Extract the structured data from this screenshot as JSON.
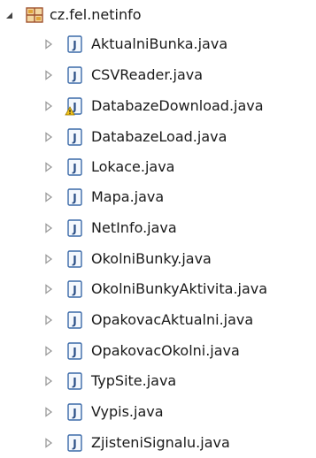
{
  "tree": {
    "package": {
      "label": "cz.fel.netinfo",
      "expanded": true,
      "icon": "package-icon"
    },
    "files": [
      {
        "label": "AktualniBunka.java",
        "icon": "java-file-icon",
        "warning": false
      },
      {
        "label": "CSVReader.java",
        "icon": "java-file-icon",
        "warning": false
      },
      {
        "label": "DatabazeDownload.java",
        "icon": "java-file-warning-icon",
        "warning": true
      },
      {
        "label": "DatabazeLoad.java",
        "icon": "java-file-icon",
        "warning": false
      },
      {
        "label": "Lokace.java",
        "icon": "java-file-icon",
        "warning": false
      },
      {
        "label": "Mapa.java",
        "icon": "java-file-icon",
        "warning": false
      },
      {
        "label": "NetInfo.java",
        "icon": "java-file-icon",
        "warning": false
      },
      {
        "label": "OkolniBunky.java",
        "icon": "java-file-icon",
        "warning": false
      },
      {
        "label": "OkolniBunkyAktivita.java",
        "icon": "java-file-icon",
        "warning": false
      },
      {
        "label": "OpakovacAktualni.java",
        "icon": "java-file-icon",
        "warning": false
      },
      {
        "label": "OpakovacOkolni.java",
        "icon": "java-file-icon",
        "warning": false
      },
      {
        "label": "TypSite.java",
        "icon": "java-file-icon",
        "warning": false
      },
      {
        "label": "Vypis.java",
        "icon": "java-file-icon",
        "warning": false
      },
      {
        "label": "ZjisteniSignalu.java",
        "icon": "java-file-icon",
        "warning": false
      }
    ]
  },
  "colors": {
    "java_icon_border": "#3b6aa8",
    "java_icon_fill": "#f4f8fd",
    "java_letter": "#2b4f86",
    "package_brown": "#a0522d",
    "package_gold": "#e0a33a",
    "warning_yellow": "#f2c21a",
    "toggle_grey": "#9a9a9a"
  }
}
